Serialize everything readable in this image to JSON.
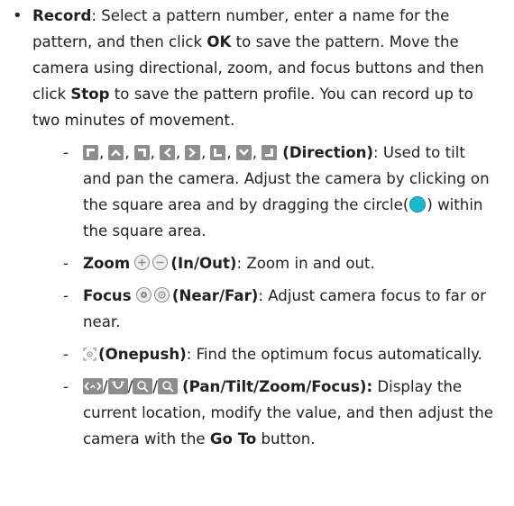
{
  "colors": {
    "text": "#231f20",
    "icon_gray": "#8b8d8f",
    "circle_teal": "#1eb9c8"
  },
  "record": {
    "bullet": "•",
    "title": "Record",
    "text_1": ": Select a pattern number, enter a name for the pattern, and then click ",
    "ok": "OK",
    "text_2": " to save the pattern. Move the camera using directional, zoom, and focus buttons and then click ",
    "stop": "Stop",
    "text_3": " to save the pattern profile. You can record up to two minutes of movement."
  },
  "items": {
    "direction": {
      "dash": "-",
      "icon_names": [
        "direction-up-left-icon",
        "direction-up-icon",
        "direction-up-right-icon",
        "direction-left-icon",
        "direction-right-icon",
        "direction-down-left-icon",
        "direction-down-icon",
        "direction-down-right-icon"
      ],
      "sep": ",",
      "label": "(Direction)",
      "text_1": ": Used to tilt and pan the camera. Adjust the camera by clicking on the square area and by dragging the circle(",
      "text_2": ") within the square area."
    },
    "zoom": {
      "dash": "-",
      "title": "Zoom",
      "icon_names": [
        "zoom-in-icon",
        "zoom-out-icon"
      ],
      "label": "(In/Out)",
      "text": ": Zoom in and out."
    },
    "focus": {
      "dash": "-",
      "title": "Focus",
      "icon_names": [
        "focus-near-icon",
        "focus-far-icon"
      ],
      "label": "(Near/Far)",
      "text": ": Adjust camera focus to far or near."
    },
    "onepush": {
      "dash": "-",
      "icon_name": "onepush-icon",
      "label": "(Onepush)",
      "text": ": Find the optimum focus automatically."
    },
    "ptzf": {
      "dash": "-",
      "icon_names": [
        "pan-icon",
        "tilt-icon",
        "zoom-icon",
        "focus-icon"
      ],
      "slash": "/",
      "label": "(Pan/Tilt/Zoom/Focus):",
      "text_1": " Display the current location, modify the value, and then adjust the camera with the ",
      "goto": "Go To",
      "text_2": " button."
    }
  }
}
